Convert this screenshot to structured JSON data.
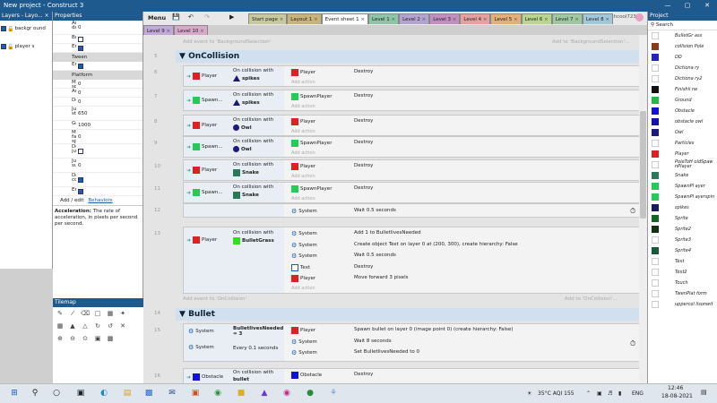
{
  "window": {
    "title": "New project - Construct 3"
  },
  "layers": {
    "header": "Layers - Layo... ×",
    "items": [
      {
        "label": "backgr ound",
        "locked": true
      },
      {
        "label": "player s",
        "locked": false
      }
    ]
  },
  "properties": {
    "header": "Properties",
    "rows": [
      {
        "label": "Angular dampi...",
        "value": "0"
      },
      {
        "label": "Bullet",
        "checkbox": false
      },
      {
        "label": "Enabled",
        "checkbox": true
      }
    ],
    "sec_tween": "Tween",
    "tween_enabled": {
      "label": "Enabled",
      "checkbox": true
    },
    "sec_platform": "Platform",
    "platform_rows": [
      {
        "label": "Max speed",
        "value": "0"
      },
      {
        "label": "Accel...",
        "value": "0"
      },
      {
        "label": "Decel...",
        "value": "0"
      },
      {
        "label": "Jump streng...",
        "value": "650"
      },
      {
        "label": "Gravity",
        "value": "1000"
      },
      {
        "label": "Max fall speed",
        "value": "0"
      },
      {
        "label": "Doubl... jump",
        "checkbox": false
      },
      {
        "label": "Jump sustain",
        "value": "0"
      },
      {
        "label": "Default contr...",
        "checkbox": true
      },
      {
        "label": "Enabled",
        "checkbox": true
      }
    ],
    "add_edit": "Add / edit",
    "behaviors": "Behaviors",
    "help_title": "Acceleration:",
    "help_text": "The rate of acceleration, in pixels per second per second."
  },
  "tilemap": {
    "header": "Tilemap"
  },
  "menubar": {
    "menu": "Menu",
    "user": "aashcool723"
  },
  "tabs": [
    {
      "label": "Start page",
      "color": "#c9c9a0"
    },
    {
      "label": "Layout 1",
      "color": "#c8b47a"
    },
    {
      "label": "Event sheet 1",
      "color": "#ffffff",
      "active": true
    },
    {
      "label": "Level 1",
      "color": "#8fc4a8"
    },
    {
      "label": "Level 2",
      "color": "#b3a3cf"
    },
    {
      "label": "Level 3",
      "color": "#c08fc0"
    },
    {
      "label": "Level 4",
      "color": "#e6a0a0"
    },
    {
      "label": "Level 5",
      "color": "#e3b07a"
    },
    {
      "label": "Level 6",
      "color": "#b9d58f"
    },
    {
      "label": "Level 7",
      "color": "#a0c8a0"
    },
    {
      "label": "Level 8",
      "color": "#a0c8d8"
    }
  ],
  "tabs2": [
    {
      "label": "Level 9",
      "color": "#c0a8d8"
    },
    {
      "label": "Level 10",
      "color": "#d8a8c8"
    }
  ],
  "sheet": {
    "add_event_to_bg": "Add event to 'BackgroundSelection'",
    "add_to_bg": "Add to 'BackgroundSelection'...",
    "group1": {
      "num": "5",
      "title": "OnCollision"
    },
    "events": [
      {
        "num": "6",
        "obj": "Player",
        "objcolor": "#e02020",
        "trigger": "On collision with",
        "target": "spikes",
        "targetcolor": "#1a1a6a",
        "tshape": "tri",
        "actions": [
          {
            "obj": "Player",
            "color": "#e02020",
            "text": "Destroy"
          }
        ]
      },
      {
        "num": "7",
        "obj": "Spawn...",
        "objcolor": "#22cc55",
        "trigger": "On collision with",
        "target": "spikes",
        "targetcolor": "#1a1a6a",
        "tshape": "tri",
        "actions": [
          {
            "obj": "SpawnPlayer",
            "color": "#22cc55",
            "text": "Destroy"
          }
        ]
      },
      {
        "num": "8",
        "obj": "Player",
        "objcolor": "#e02020",
        "trigger": "On collision with",
        "target": "Owl",
        "targetcolor": "#1a1a80",
        "tshape": "circle",
        "actions": [
          {
            "obj": "Player",
            "color": "#e02020",
            "text": "Destroy"
          }
        ]
      },
      {
        "num": "9",
        "obj": "Spawn...",
        "objcolor": "#22cc55",
        "trigger": "On collision with",
        "target": "Owl",
        "targetcolor": "#1a1a80",
        "tshape": "circle",
        "actions": [
          {
            "obj": "SpawnPlayer",
            "color": "#22cc55",
            "text": "Destroy"
          }
        ]
      },
      {
        "num": "10",
        "obj": "Player",
        "objcolor": "#e02020",
        "trigger": "On collision with",
        "target": "Snake",
        "targetcolor": "#2a7a5a",
        "tshape": "sq",
        "actions": [
          {
            "obj": "Player",
            "color": "#e02020",
            "text": "Destroy"
          }
        ]
      },
      {
        "num": "11",
        "obj": "Spawn...",
        "objcolor": "#22cc55",
        "trigger": "On collision with",
        "target": "Snake",
        "targetcolor": "#2a7a5a",
        "tshape": "sq",
        "actions": [
          {
            "obj": "SpawnPlayer",
            "color": "#22cc55",
            "text": "Destroy"
          }
        ]
      }
    ],
    "ev12": {
      "num": "12",
      "system": "System",
      "action": "Wait 0.5 seconds"
    },
    "ev13": {
      "num": "13",
      "obj": "Player",
      "trigger": "On collision with",
      "target": "BulletGrass",
      "actions": [
        {
          "obj": "System",
          "text": "Add 1 to BulletlivesNeeded"
        },
        {
          "obj": "System",
          "text": "Create object  Text on layer 0 at (200, 300), create hierarchy: False"
        },
        {
          "obj": "System",
          "text": "Wait 0.5 seconds"
        },
        {
          "obj": "Text",
          "text": "Destroy"
        },
        {
          "obj": "Player",
          "text": "Move forward 3 pixels"
        }
      ]
    },
    "add_action": "Add action",
    "add_event_to_oncollision": "Add event to 'OnCollision'",
    "add_to_oncollision": "Add to 'OnCollision'...",
    "group2": {
      "num": "14",
      "title": "Bullet"
    },
    "ev15": {
      "num": "15",
      "c1obj": "System",
      "c1text": "BulletlivesNeeded = 3",
      "c2obj": "System",
      "c2text": "Every 0.1 seconds",
      "actions": [
        {
          "obj": "Player",
          "text": "Spawn  bullet on layer 0 (image point 0) (create hierarchy: False)"
        },
        {
          "obj": "System",
          "text": "Wait 8 seconds"
        },
        {
          "obj": "System",
          "text": "Set BulletlivesNeeded to 0"
        }
      ]
    },
    "ev16": {
      "num": "16",
      "obj": "Obstacle",
      "trigger": "On collision with",
      "target": "bullet",
      "action_obj": "Obstacle",
      "action": "Destroy"
    }
  },
  "project": {
    "header": "Project",
    "search": "Search",
    "items": [
      {
        "label": "BulletGr ass",
        "color": "#ffffff"
      },
      {
        "label": "collision Pole",
        "color": "#8b3a1a"
      },
      {
        "label": "DD",
        "color": "#2222cc"
      },
      {
        "label": "Dictiona ry",
        "color": "#ffffff"
      },
      {
        "label": "Dictiona ry2",
        "color": "#ffffff"
      },
      {
        "label": "Finishli ne",
        "color": "#111111"
      },
      {
        "label": "Ground",
        "color": "#22bb44"
      },
      {
        "label": "Obstacle",
        "color": "#1111dd"
      },
      {
        "label": "obstacle owl",
        "color": "#1111bb"
      },
      {
        "label": "Owl",
        "color": "#1a1a80"
      },
      {
        "label": "Particles",
        "color": "#ffffff"
      },
      {
        "label": "Player",
        "color": "#e02020"
      },
      {
        "label": "PoleToH oldSpaw nPlayer",
        "color": "#ffffff"
      },
      {
        "label": "Snake",
        "color": "#2a7a5a"
      },
      {
        "label": "SpawnPl ayer",
        "color": "#22cc55"
      },
      {
        "label": "SpawnPl ayerspin",
        "color": "#22cc55"
      },
      {
        "label": "spikes",
        "color": "#1a1a6a"
      },
      {
        "label": "Sprite",
        "color": "#116622"
      },
      {
        "label": "Sprite2",
        "color": "#113311"
      },
      {
        "label": "Sprite3",
        "color": "#ffffff"
      },
      {
        "label": "Sprite4",
        "color": "#1a5a3a"
      },
      {
        "label": "Text",
        "color": "#ffffff"
      },
      {
        "label": "Text2",
        "color": "#ffffff"
      },
      {
        "label": "Touch",
        "color": "#ffffff"
      },
      {
        "label": "TwenPlat form",
        "color": "#ffffff"
      },
      {
        "label": "uppercol lisonwit",
        "color": "#ffffff"
      }
    ]
  },
  "taskbar": {
    "weather": "35°C  AQI 155",
    "lang": "ENG",
    "time": "12:46",
    "date": "18-08-2021"
  }
}
